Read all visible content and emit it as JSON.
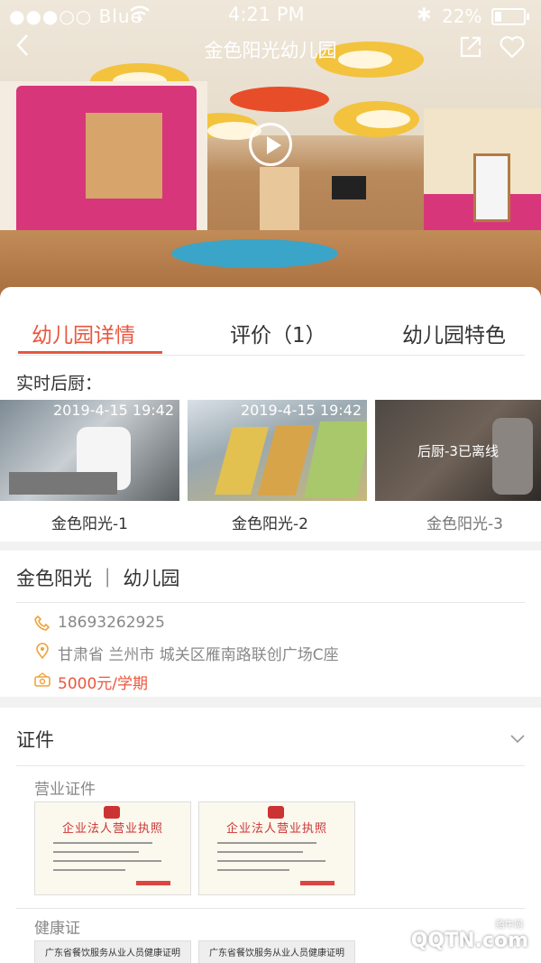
{
  "status_bar": {
    "carrier": "●●●○○ Blue",
    "time": "4:21 PM",
    "battery": "22%"
  },
  "nav": {
    "title": "金色阳光幼儿园",
    "back_icon": "chevron-left-icon",
    "share_icon": "share-icon",
    "favorite_icon": "heart-icon"
  },
  "hero": {
    "play_icon": "play-icon"
  },
  "tabs": [
    {
      "label": "幼儿园详情",
      "active": true
    },
    {
      "label": "评价（1）",
      "active": false
    },
    {
      "label": "幼儿园特色",
      "active": false
    }
  ],
  "kitchen": {
    "label": "实时后厨：",
    "cameras": [
      {
        "name": "金色阳光-1",
        "timestamp": "2019-4-15 19:42",
        "status": ""
      },
      {
        "name": "金色阳光-2",
        "timestamp": "2019-4-15 19:42",
        "status": ""
      },
      {
        "name": "金色阳光-3",
        "timestamp": "",
        "status": "后厨-3已离线"
      }
    ]
  },
  "info": {
    "name": "金色阳光 ｜ 幼儿园",
    "phone": "18693262925",
    "address": "甘肃省 兰州市 城关区雁南路联创广场C座",
    "price": "5000元/学期"
  },
  "certs": {
    "header": "证件",
    "business_label": "营业证件",
    "license_title": "企业法人营业执照",
    "health_label": "健康证",
    "health_title": "广东省餐饮服务从业人员健康证明"
  },
  "colors": {
    "accent": "#e9573f"
  },
  "watermark": {
    "text": "QQTN.com",
    "small": "腾牛网"
  }
}
